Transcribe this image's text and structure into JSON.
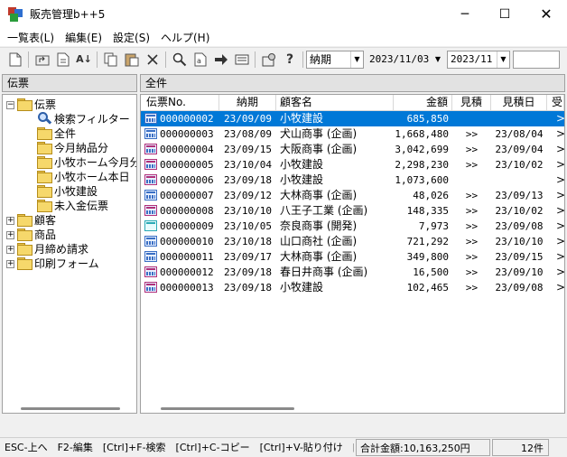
{
  "window": {
    "title": "販売管理b++5",
    "minimize": "─",
    "maximize": "☐",
    "close": "✕"
  },
  "menu": [
    "一覧表(L)",
    "編集(E)",
    "設定(S)",
    "ヘルプ(H)"
  ],
  "toolbar": {
    "date_field": {
      "value": "納期"
    },
    "date_value": {
      "value": "2023/11/03"
    },
    "month_value": {
      "value": "2023/11"
    },
    "search": {
      "value": ""
    }
  },
  "left_pane": {
    "header": "伝票",
    "tree": [
      {
        "label": "伝票"
      },
      {
        "label": "検索フィルター"
      },
      {
        "label": "全件"
      },
      {
        "label": "今月納品分"
      },
      {
        "label": "小牧ホーム今月分"
      },
      {
        "label": "小牧ホーム本日"
      },
      {
        "label": "小牧建設"
      },
      {
        "label": "未入金伝票"
      },
      {
        "label": "顧客"
      },
      {
        "label": "商品"
      },
      {
        "label": "月締め請求"
      },
      {
        "label": "印刷フォーム"
      }
    ]
  },
  "right_pane": {
    "header": "全件",
    "columns": [
      "伝票No.",
      "納期",
      "顧客名",
      "金額",
      "見積",
      "見積日",
      "受"
    ],
    "rows": [
      {
        "no": "000000002",
        "due": "23/09/09",
        "customer": "小牧建設",
        "amount": "685,850",
        "est": "",
        "est_date": "",
        "icon": "blue",
        "selected": true
      },
      {
        "no": "000000003",
        "due": "23/08/09",
        "customer": "犬山商事 (企画)",
        "amount": "1,668,480",
        "est": ">>",
        "est_date": "23/08/04",
        "icon": "blue"
      },
      {
        "no": "000000004",
        "due": "23/09/15",
        "customer": "大阪商事 (企画)",
        "amount": "3,042,699",
        "est": ">>",
        "est_date": "23/09/04",
        "icon": "pink"
      },
      {
        "no": "000000005",
        "due": "23/10/04",
        "customer": "小牧建設",
        "amount": "2,298,230",
        "est": ">>",
        "est_date": "23/10/02",
        "icon": "pink"
      },
      {
        "no": "000000006",
        "due": "23/09/18",
        "customer": "小牧建設",
        "amount": "1,073,600",
        "est": "",
        "est_date": "",
        "icon": "pink"
      },
      {
        "no": "000000007",
        "due": "23/09/12",
        "customer": "大林商事 (企画)",
        "amount": "48,026",
        "est": ">>",
        "est_date": "23/09/13",
        "icon": "blue"
      },
      {
        "no": "000000008",
        "due": "23/10/10",
        "customer": "八王子工業 (企画)",
        "amount": "148,335",
        "est": ">>",
        "est_date": "23/10/02",
        "icon": "pink"
      },
      {
        "no": "000000009",
        "due": "23/10/05",
        "customer": "奈良商事 (開発)",
        "amount": "7,973",
        "est": ">>",
        "est_date": "23/09/08",
        "icon": "cyan"
      },
      {
        "no": "000000010",
        "due": "23/10/18",
        "customer": "山口商社 (企画)",
        "amount": "721,292",
        "est": ">>",
        "est_date": "23/10/10",
        "icon": "blue"
      },
      {
        "no": "000000011",
        "due": "23/09/17",
        "customer": "大林商事 (企画)",
        "amount": "349,800",
        "est": ">>",
        "est_date": "23/09/15",
        "icon": "blue"
      },
      {
        "no": "000000012",
        "due": "23/09/18",
        "customer": "春日井商事 (企画)",
        "amount": "16,500",
        "est": ">>",
        "est_date": "23/09/10",
        "icon": "pink"
      },
      {
        "no": "000000013",
        "due": "23/09/18",
        "customer": "小牧建設",
        "amount": "102,465",
        "est": ">>",
        "est_date": "23/09/08",
        "icon": "pink"
      }
    ],
    "row_arrow": ">"
  },
  "status": {
    "hints": "ESC-上へ　F2-編集　[Ctrl]+F-検索　[Ctrl]+C-コピー　[Ctrl]+V-貼り付け　[C",
    "total": "合計金額:10,163,250円",
    "count": "12件"
  },
  "colors": {
    "selection": "#0078d7"
  }
}
